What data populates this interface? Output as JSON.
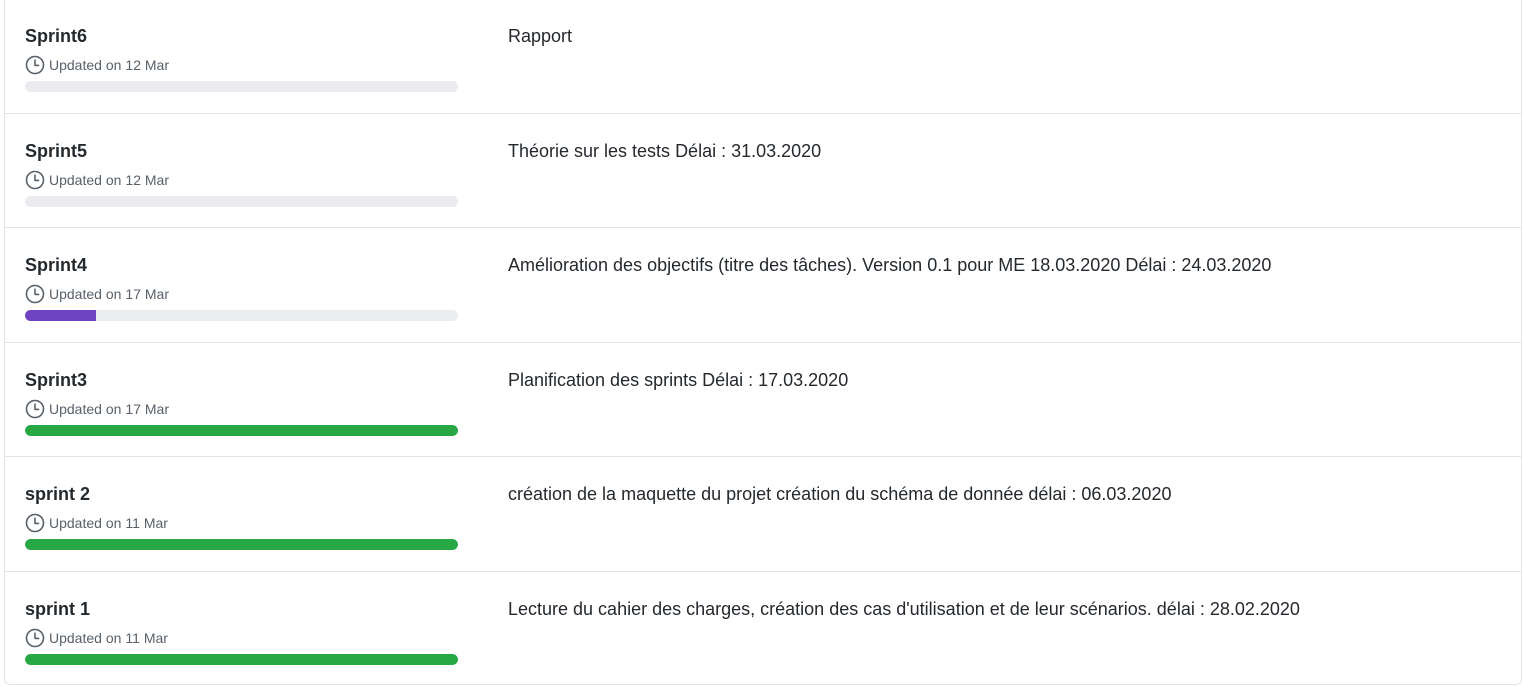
{
  "milestones": [
    {
      "title": "Sprint6",
      "updated_label": "Updated on",
      "updated_date": "12 Mar",
      "progress": 0,
      "progress_color": "#eaecef",
      "description": "Rapport"
    },
    {
      "title": "Sprint5",
      "updated_label": "Updated on",
      "updated_date": "12 Mar",
      "progress": 0,
      "progress_color": "#eaecef",
      "description": "Théorie sur les tests Délai : 31.03.2020"
    },
    {
      "title": "Sprint4",
      "updated_label": "Updated on",
      "updated_date": "17 Mar",
      "progress": 0.165,
      "progress_color": "#6f42c1",
      "description": "Amélioration des objectifs (titre des tâches). Version 0.1 pour ME 18.03.2020 Délai : 24.03.2020"
    },
    {
      "title": "Sprint3",
      "updated_label": "Updated on",
      "updated_date": "17 Mar",
      "progress": 1,
      "progress_color": "#28a745",
      "description": "Planification des sprints Délai : 17.03.2020"
    },
    {
      "title": "sprint 2",
      "updated_label": "Updated on",
      "updated_date": "11 Mar",
      "progress": 1,
      "progress_color": "#28a745",
      "description": "création de la maquette du projet création du schéma de donnée délai : 06.03.2020"
    },
    {
      "title": "sprint 1",
      "updated_label": "Updated on",
      "updated_date": "11 Mar",
      "progress": 1,
      "progress_color": "#28a745",
      "description": "Lecture du cahier des charges, création des cas d'utilisation et de leur scénarios. délai : 28.02.2020"
    }
  ]
}
